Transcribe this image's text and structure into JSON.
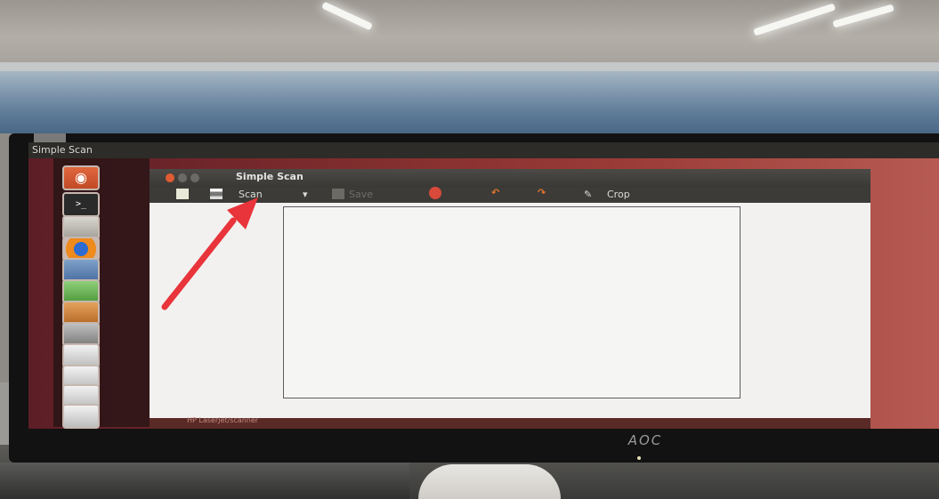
{
  "panel": {
    "title": "Simple Scan"
  },
  "window": {
    "title": "Simple Scan"
  },
  "toolbar": {
    "scan_label": "Scan",
    "scan_dropdown": "▾",
    "save_label": "Save",
    "crop_label": "Crop"
  },
  "status": {
    "text": "HP LaserJet/scanner"
  },
  "monitor": {
    "brand": "AOC"
  },
  "launcher": {
    "items": [
      {
        "icon": "ubuntu-dash-icon"
      },
      {
        "icon": "terminal-icon",
        "glyph": ">_"
      },
      {
        "icon": "app-icon"
      },
      {
        "icon": "firefox-icon"
      },
      {
        "icon": "writer-icon"
      },
      {
        "icon": "calc-icon"
      },
      {
        "icon": "impress-icon"
      },
      {
        "icon": "settings-icon"
      },
      {
        "icon": "drive-icon"
      },
      {
        "icon": "printer-icon"
      },
      {
        "icon": "scanner-icon"
      },
      {
        "icon": "printer-icon"
      }
    ]
  },
  "colors": {
    "window_close": "#e05b34",
    "annotation_arrow": "#e8343a",
    "desktop": "#9b3b37"
  }
}
